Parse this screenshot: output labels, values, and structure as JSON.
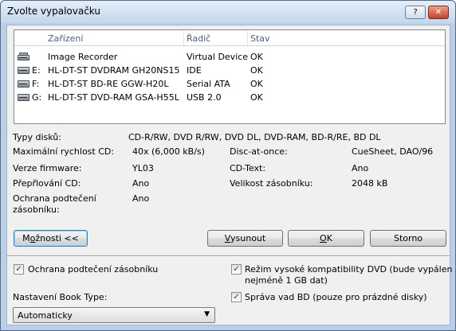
{
  "window": {
    "title": "Zvolte vypalovačku",
    "help_label": "?",
    "close_label": "✕"
  },
  "columns": {
    "device": "Zařízení",
    "controller": "Řadič",
    "status": "Stav"
  },
  "devices": [
    {
      "letter": "",
      "name": "Image Recorder",
      "controller": "Virtual Device",
      "status": "OK",
      "icon": "recorder-icon"
    },
    {
      "letter": "E:",
      "name": "HL-DT-ST DVDRAM GH20NS15",
      "controller": "IDE",
      "status": "OK",
      "icon": "drive-icon"
    },
    {
      "letter": "F:",
      "name": "HL-DT-ST BD-RE  GGW-H20L",
      "controller": "Serial ATA",
      "status": "OK",
      "icon": "drive-icon"
    },
    {
      "letter": "G:",
      "name": "HL-DT-ST DVD-RAM GSA-H55L",
      "controller": "USB 2.0",
      "status": "OK",
      "icon": "drive-icon"
    }
  ],
  "info": {
    "disc_types_label": "Typy disků:",
    "disc_types_value": "CD-R/RW, DVD R/RW, DVD DL, DVD-RAM, BD-R/RE, BD DL",
    "max_speed_label": "Maximální rychlost CD:",
    "max_speed_value": "40x (6,000 kB/s)",
    "dao_label": "Disc-at-once:",
    "dao_value": "CueSheet, DAO/96",
    "firmware_label": "Verze firmware:",
    "firmware_value": "YL03",
    "cdtext_label": "CD-Text:",
    "cdtext_value": "Ano",
    "overburn_label": "Přepřlování CD:",
    "overburn_value": "Ano",
    "buffer_label": "Velikost zásobníku:",
    "buffer_value": "2048 kB",
    "underrun_label_1": "Ochrana podtečení",
    "underrun_label_2": "zásobníku:",
    "underrun_value": "Ano"
  },
  "buttons": {
    "options_prefix": "M",
    "options_hot": "o",
    "options_rest": "žnosti <<",
    "eject_prefix": "",
    "eject_hot": "V",
    "eject_rest": "ysunout",
    "ok_hot": "O",
    "ok_rest": "K",
    "cancel_label": "Storno"
  },
  "options": {
    "underrun_protection": {
      "label": "Ochrana podtečení zásobníku",
      "checked": true
    },
    "dvd_compat": {
      "label_1": "Režim vysoké kompatibility DVD (bude vypálen",
      "label_2": "nejméně 1 GB dat)",
      "checked": true
    },
    "bd_defect": {
      "label": "Správa vad BD (pouze pro prázdné disky)",
      "checked": true
    },
    "book_type_label": "Nastavení Book Type:",
    "book_type_value": "Automaticky"
  }
}
